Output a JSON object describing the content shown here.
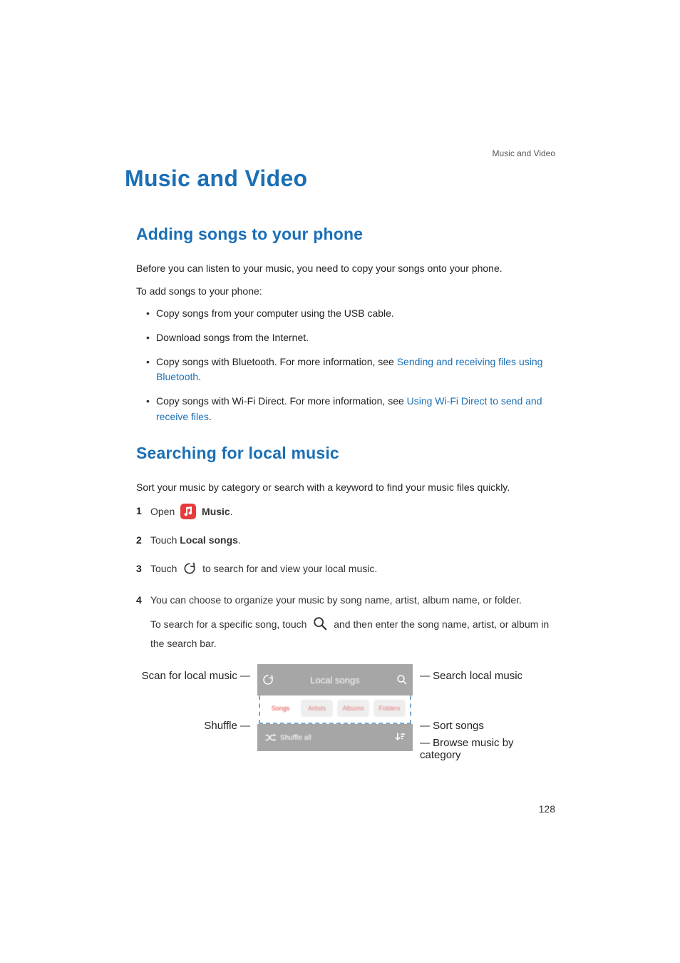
{
  "running_head": "Music and Video",
  "chapter_title": "Music and Video",
  "section_adding": {
    "title": "Adding songs to your phone",
    "p1": "Before you can listen to your music, you need to copy your songs onto your phone.",
    "p2": "To add songs to your phone:",
    "bullets": {
      "b1": "Copy songs from your computer using the USB cable.",
      "b2": "Download songs from the Internet.",
      "b3_pre": "Copy songs with Bluetooth. For more information, see ",
      "b3_link": "Sending and receiving files using Bluetooth",
      "b3_post": ".",
      "b4_pre": "Copy songs with Wi-Fi Direct. For more information, see ",
      "b4_link": "Using Wi-Fi Direct to send and receive files",
      "b4_post": "."
    }
  },
  "section_search": {
    "title": "Searching for local music",
    "p1": "Sort your music by category or search with a keyword to find your music files quickly.",
    "step1_pre": "Open ",
    "step1_app": "Music",
    "step1_post": ".",
    "step2_pre": "Touch ",
    "step2_bold": "Local songs",
    "step2_post": ".",
    "step3_pre": "Touch ",
    "step3_post": " to search for and view your local music.",
    "step4_a": "You can choose to organize your music by song name, artist, album name, or folder.",
    "step4_b_pre": "To search for a specific song, touch ",
    "step4_b_post": " and then enter the song name, artist, or album in the search bar."
  },
  "figure": {
    "topbar_title": "Local songs",
    "tabs": [
      "Songs",
      "Artists",
      "Albums",
      "Folders"
    ],
    "shuffle_label": "Shuffle all",
    "callouts": {
      "scan": "Scan for local music",
      "shuffle": "Shuffle",
      "search": "Search local music",
      "sort": "Sort songs",
      "browse": "Browse music by category"
    }
  },
  "page_number": "128"
}
